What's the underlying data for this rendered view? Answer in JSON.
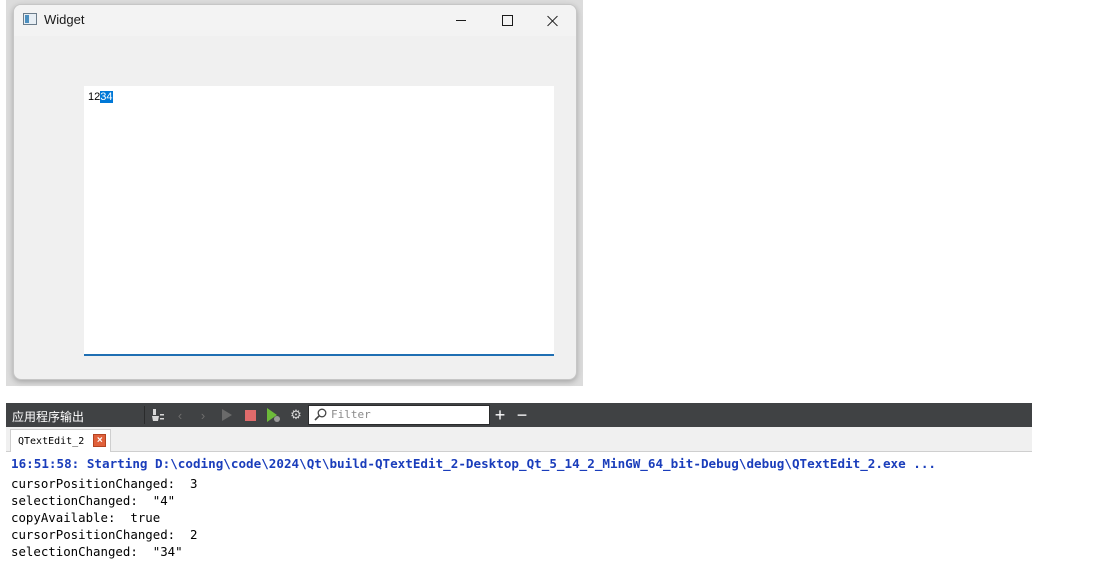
{
  "window": {
    "title": "Widget",
    "minimize_label": "–",
    "maximize_label": "□",
    "close_label": "✕"
  },
  "text_edit": {
    "plain_text": "12",
    "selected_text": "34"
  },
  "output_pane": {
    "title": "应用程序输出",
    "filter_placeholder": "Filter",
    "toolbar_icons": [
      "clear-icon",
      "prev-icon",
      "next-icon",
      "run-icon",
      "stop-icon",
      "rerun-debug-icon",
      "settings-icon",
      "search-icon",
      "zoom-in-icon",
      "zoom-out-icon"
    ],
    "plus_label": "+",
    "minus_label": "−",
    "tab_label": "QTextEdit_2",
    "tab_close_label": "×",
    "lines": [
      "16:51:58: Starting D:\\coding\\code\\2024\\Qt\\build-QTextEdit_2-Desktop_Qt_5_14_2_MinGW_64_bit-Debug\\debug\\QTextEdit_2.exe ...",
      "cursorPositionChanged:  3",
      "selectionChanged:  \"4\"",
      "copyAvailable:  true",
      "cursorPositionChanged:  2",
      "selectionChanged:  \"34\""
    ]
  },
  "colors": {
    "selection": "#0078d7",
    "start_line": "#1a3dbb",
    "toolbar_bg": "#404244",
    "stop": "#e06b6b",
    "run_debug": "#6dbb3a"
  }
}
